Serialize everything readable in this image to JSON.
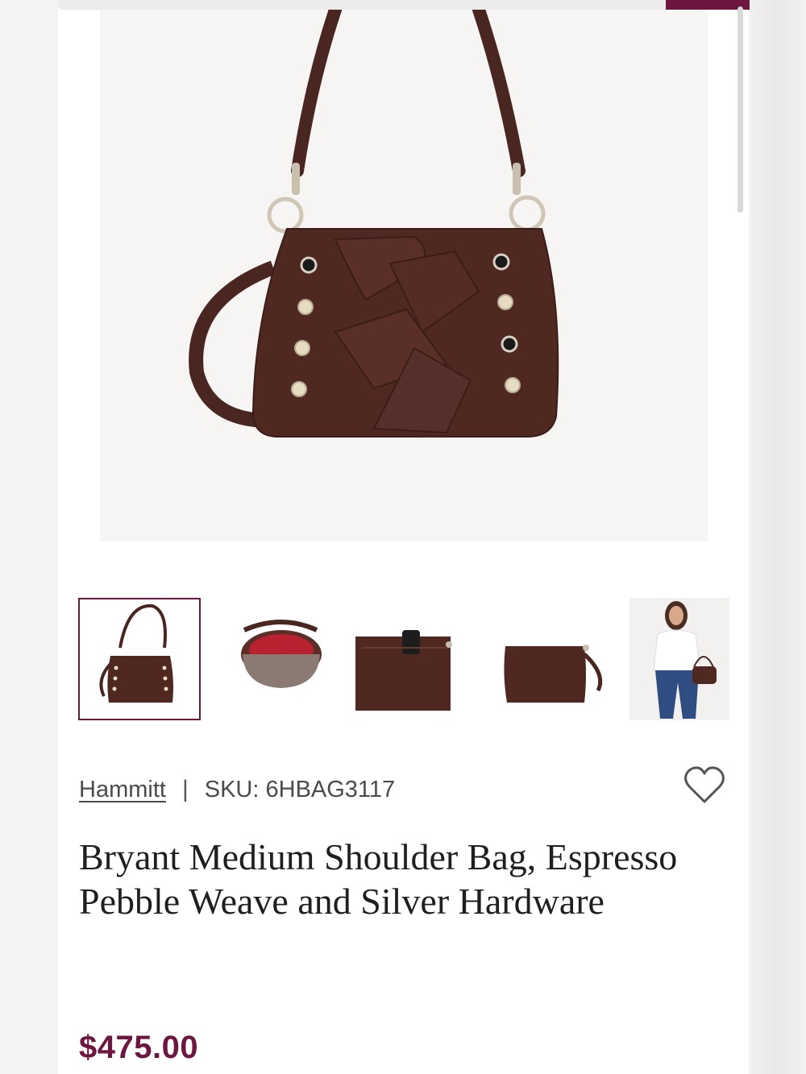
{
  "product": {
    "brand": "Hammitt",
    "divider": "|",
    "sku": "SKU: 6HBAG3117",
    "title": "Bryant Medium Shoulder Bag, Espresso Pebble Weave and Silver Hardware",
    "price": "$475.00"
  },
  "gallery": {
    "main_image": "product-main-image",
    "thumbnails": [
      {
        "name": "bag-front",
        "selected": true
      },
      {
        "name": "bag-interior",
        "selected": false
      },
      {
        "name": "bag-back-pocket",
        "selected": false
      },
      {
        "name": "bag-side",
        "selected": false
      },
      {
        "name": "model-wearing-bag",
        "selected": false
      }
    ]
  },
  "icons": {
    "wishlist": "heart-icon"
  },
  "colors": {
    "accent": "#6d1740",
    "leather": "#4a2620",
    "text": "#1f1f1f",
    "muted_text": "#4b4b4b"
  }
}
